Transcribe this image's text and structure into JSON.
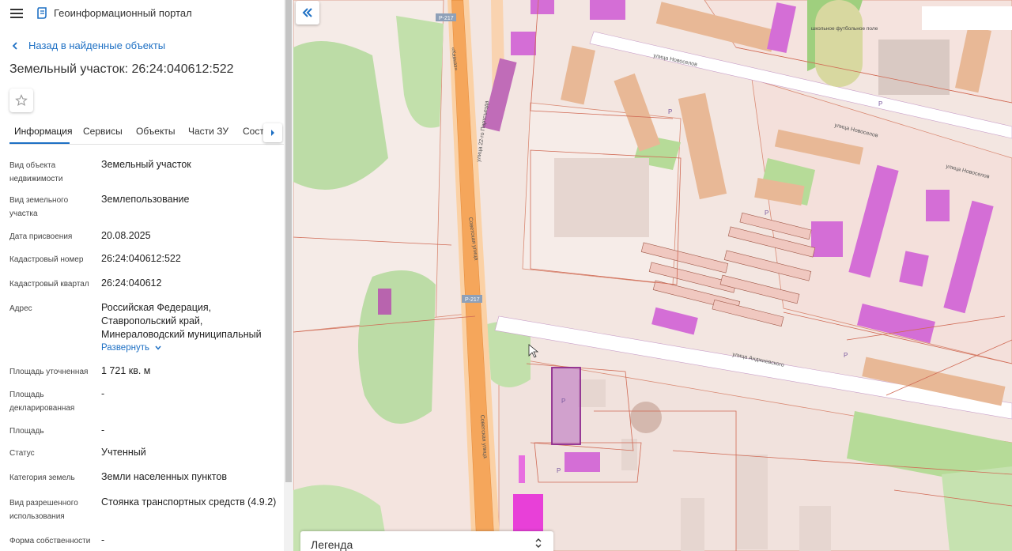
{
  "app": {
    "title": "Геоинформационный портал"
  },
  "nav": {
    "back_label": "Назад в найденные объекты"
  },
  "object": {
    "title": "Земельный участок: 26:24:040612:522"
  },
  "tabs": [
    {
      "label": "Информация"
    },
    {
      "label": "Сервисы"
    },
    {
      "label": "Объекты"
    },
    {
      "label": "Части ЗУ"
    },
    {
      "label": "Соста..."
    }
  ],
  "fields": [
    {
      "label": "Вид объекта недвижимости",
      "value": "Земельный участок"
    },
    {
      "label": "Вид земельного участка",
      "value": "Землепользование"
    },
    {
      "label": "Дата присвоения",
      "value": "20.08.2025"
    },
    {
      "label": "Кадастровый номер",
      "value": "26:24:040612:522"
    },
    {
      "label": "Кадастровый квартал",
      "value": "26:24:040612"
    },
    {
      "label": "Адрес",
      "value": "Российская Федерация, Ставропольский край, Минераловодский муниципальный"
    },
    {
      "label": "Площадь уточненная",
      "value": "1 721 кв. м"
    },
    {
      "label": "Площадь декларированная",
      "value": "-"
    },
    {
      "label": "Площадь",
      "value": "-"
    },
    {
      "label": "Статус",
      "value": "Учтенный"
    },
    {
      "label": "Категория земель",
      "value": "Земли населенных пунктов"
    },
    {
      "label": "Вид разрешенного использования",
      "value": "Стоянка транспортных средств (4.9.2)"
    },
    {
      "label": "Форма собственности",
      "value": "-"
    }
  ],
  "address_expand_label": "Развернуть",
  "map": {
    "legend_label": "Легенда",
    "labels": {
      "road_r217": "Р-217",
      "street_22_partsezda": "улица 22-го Партсъезда",
      "kavkaz": "«Кавказ»",
      "sovetskaya": "Советская улица",
      "novoselov": "улица Новоселов",
      "andzhievskogo": "улица Анджиевского",
      "football": "школьное футбольное поле",
      "parking": "P"
    },
    "colors": {
      "road_orange": "#f5a65b",
      "parcel_pink": "#f4ddd7",
      "building_tan": "#e8b896",
      "building_magenta": "#d46ed6",
      "green": "#b8dca0",
      "selected_outline": "#8e2a8e"
    }
  },
  "icons": {
    "menu": "hamburger-icon",
    "logo": "portal-logo-icon",
    "back": "chevron-left-icon",
    "favorite": "star-icon",
    "tab_next": "chevron-right-icon",
    "expand": "chevron-down-icon",
    "collapse": "double-chevron-left-icon",
    "legend": "sort-arrows-icon"
  }
}
